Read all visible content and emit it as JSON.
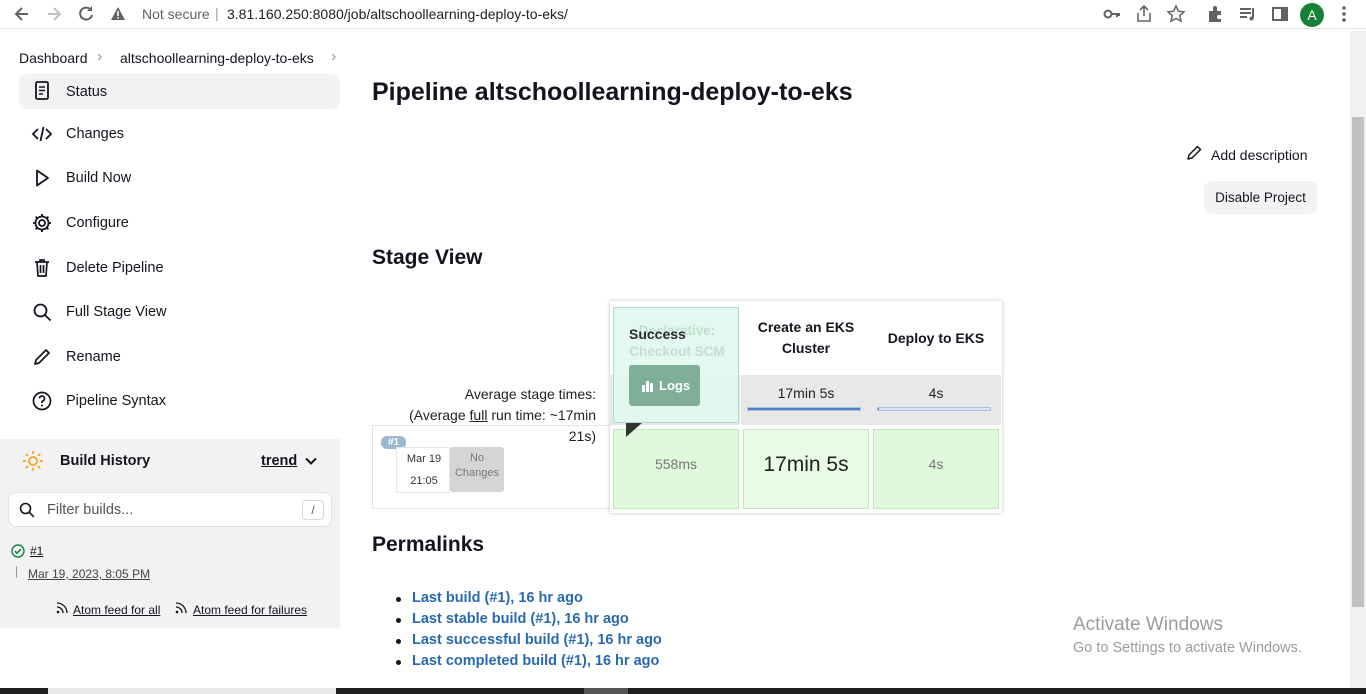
{
  "browser": {
    "security": "Not secure",
    "url": "3.81.160.250:8080/job/altschoollearning-deploy-to-eks/",
    "avatar_letter": "A"
  },
  "breadcrumb": {
    "items": [
      "Dashboard",
      "altschoollearning-deploy-to-eks"
    ]
  },
  "sidebar": {
    "items": [
      {
        "label": "Status",
        "icon": "document-icon"
      },
      {
        "label": "Changes",
        "icon": "code-icon"
      },
      {
        "label": "Build Now",
        "icon": "play-icon"
      },
      {
        "label": "Configure",
        "icon": "gear-icon"
      },
      {
        "label": "Delete Pipeline",
        "icon": "trash-icon"
      },
      {
        "label": "Full Stage View",
        "icon": "search-icon"
      },
      {
        "label": "Rename",
        "icon": "pencil-icon"
      },
      {
        "label": "Pipeline Syntax",
        "icon": "help-icon"
      }
    ]
  },
  "build_history": {
    "title": "Build History",
    "trend": "trend",
    "filter_placeholder": "Filter builds...",
    "shortcut": "/",
    "builds": [
      {
        "number": "#1",
        "date": "Mar 19, 2023, 8:05 PM",
        "status": "success"
      }
    ],
    "feed_all": "Atom feed for all",
    "feed_failures": "Atom feed for failures"
  },
  "main": {
    "title": "Pipeline altschoollearning-deploy-to-eks",
    "add_description": "Add description",
    "disable_project": "Disable Project",
    "stage_view_title": "Stage View",
    "permalinks_title": "Permalinks"
  },
  "stage_view": {
    "avg_stage_times": "Average stage times:",
    "avg_full_prefix": "(Average ",
    "avg_full_word": "full",
    "avg_full_suffix": " run time: ~17min",
    "avg_full_line2": "21s)",
    "run_badge": "#1",
    "run_date": "Mar 19",
    "run_time": "21:05",
    "no_changes": "No Changes",
    "stages": [
      {
        "name": "Declarative: Checkout SCM",
        "avg": "558ms",
        "duration": "558ms",
        "avg_fraction": 0.0
      },
      {
        "name": "Create an EKS Cluster",
        "avg": "17min 5s",
        "duration": "17min 5s",
        "avg_fraction": 1.0
      },
      {
        "name": "Deploy to EKS",
        "avg": "4s",
        "duration": "4s",
        "avg_fraction": 0.004
      }
    ],
    "popup": {
      "status": "Success",
      "logs": "Logs"
    }
  },
  "permalinks": [
    "Last build (#1), 16 hr ago",
    "Last stable build (#1), 16 hr ago",
    "Last successful build (#1), 16 hr ago",
    "Last completed build (#1), 16 hr ago"
  ],
  "watermark": {
    "line1": "Activate Windows",
    "line2": "Go to Settings to activate Windows."
  },
  "colors": {
    "success": "#138347",
    "link": "#2969b0",
    "stage_success": "#e0f9dc"
  }
}
